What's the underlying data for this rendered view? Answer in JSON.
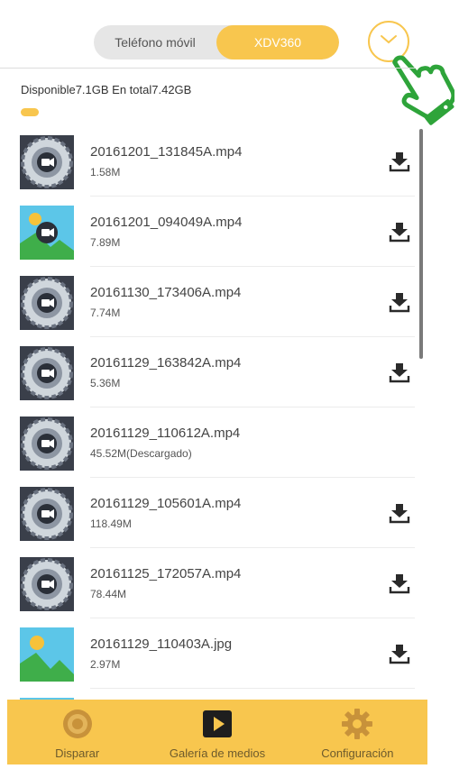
{
  "header": {
    "tabs": [
      "Teléfono móvil",
      "XDV360"
    ],
    "active_tab": "XDV360"
  },
  "storage": {
    "text": "Disponible7.1GB En total7.42GB"
  },
  "files": [
    {
      "name": "20161201_131845A.mp4",
      "size": "1.58M",
      "type": "video",
      "downloadable": true
    },
    {
      "name": "20161201_094049A.mp4",
      "size": "7.89M",
      "type": "video",
      "downloadable": true
    },
    {
      "name": "20161130_173406A.mp4",
      "size": "7.74M",
      "type": "video",
      "downloadable": true
    },
    {
      "name": "20161129_163842A.mp4",
      "size": "5.36M",
      "type": "video",
      "downloadable": true
    },
    {
      "name": "20161129_110612A.mp4",
      "size": "45.52M(Descargado)",
      "type": "video",
      "downloadable": false
    },
    {
      "name": "20161129_105601A.mp4",
      "size": "118.49M",
      "type": "video",
      "downloadable": true
    },
    {
      "name": "20161125_172057A.mp4",
      "size": "78.44M",
      "type": "video",
      "downloadable": true
    },
    {
      "name": "20161129_110403A.jpg",
      "size": "2.97M",
      "type": "image",
      "downloadable": true
    }
  ],
  "nav": [
    {
      "label": "Disparar",
      "icon": "camera-lens-icon"
    },
    {
      "label": "Galería de medios",
      "icon": "play-icon"
    },
    {
      "label": "Configuración",
      "icon": "gear-icon"
    }
  ],
  "colors": {
    "accent": "#f8c64e",
    "hand": "#2ea43a"
  }
}
